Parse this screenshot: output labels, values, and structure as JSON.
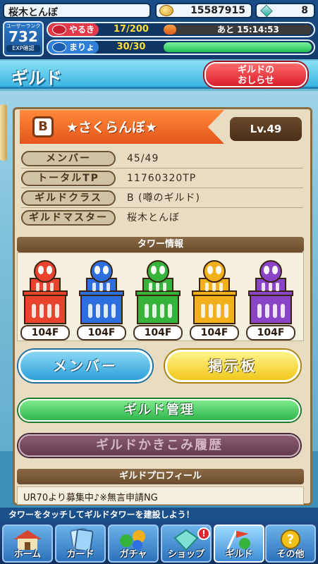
{
  "status": {
    "player_name": "桜木とんぼ",
    "coins": "15587915",
    "gems": "8",
    "rank_label": "ユーザーランク",
    "rank_value": "732",
    "exp_label": "EXP確認",
    "yaruki_label": "やるき",
    "yaruki_value": "17/200",
    "yaruki_timer": "あと 15:14:53",
    "yaruki_fraction": 0.085,
    "maryoku_label": "まりょく",
    "maryoku_value": "30/30",
    "maryoku_fraction": 1.0
  },
  "header": {
    "title": "ギルド",
    "news_button_line1": "ギルドの",
    "news_button_line2": "おしらせ"
  },
  "guild": {
    "rank": "B",
    "name": "★さくらんぼ★",
    "level": "Lv.49",
    "rows": [
      {
        "label": "メンバー",
        "value": "45/49"
      },
      {
        "label": "トータルTP",
        "value": "11760320TP"
      },
      {
        "label": "ギルドクラス",
        "value": "B (噂のギルド)"
      },
      {
        "label": "ギルドマスター",
        "value": "桜木とんぼ"
      }
    ]
  },
  "towers": {
    "title": "タワー情報",
    "items": [
      {
        "color": "red",
        "fill": "#e8432d",
        "floor": "104F"
      },
      {
        "color": "blue",
        "fill": "#2e6fe0",
        "floor": "104F"
      },
      {
        "color": "green",
        "fill": "#36b33a",
        "floor": "104F"
      },
      {
        "color": "yellow",
        "fill": "#f2b01c",
        "floor": "104F"
      },
      {
        "color": "purple",
        "fill": "#8a44c8",
        "floor": "104F"
      }
    ]
  },
  "buttons": {
    "member": "メンバー",
    "board": "掲示板",
    "manage": "ギルド管理",
    "history": "ギルドかきこみ履歴"
  },
  "profile": {
    "title": "ギルドプロフィール",
    "text": "UR70より募集中♪※無言申請NG"
  },
  "ticker": "タワーをタッチしてギルドタワーを建設しよう！",
  "tabs": [
    {
      "label": "ホーム",
      "icon": "house-icon"
    },
    {
      "label": "カード",
      "icon": "card-icon"
    },
    {
      "label": "ガチャ",
      "icon": "gacha-icon"
    },
    {
      "label": "ショップ",
      "icon": "shop-icon"
    },
    {
      "label": "ギルド",
      "icon": "guild-icon"
    },
    {
      "label": "その他",
      "icon": "question-icon"
    }
  ],
  "shop_alert": "!"
}
